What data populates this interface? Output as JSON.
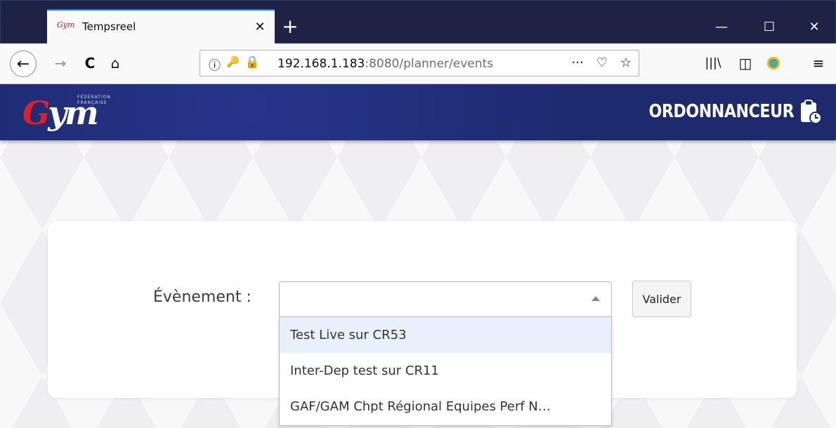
{
  "browser": {
    "tab": {
      "title": "Tempsreel",
      "favicon_text": "Gym"
    },
    "url": {
      "host": "192.168.1.183",
      "rest": ":8080/planner/events"
    },
    "icons": {
      "back": "back-arrow-icon",
      "forward": "forward-arrow-icon",
      "reload": "reload-icon",
      "home": "home-icon",
      "info": "info-icon",
      "key": "key-icon",
      "insecure": "insecure-lock-icon",
      "page_actions": "more-dots-icon",
      "pocket": "pocket-icon",
      "bookmark": "star-icon",
      "library": "library-icon",
      "sidebar": "sidebar-icon",
      "extension": "extension-icon",
      "menu": "hamburger-icon"
    }
  },
  "header": {
    "logo_small": "FÉDÉRATION FRANÇAISE",
    "logo_script": "Gym",
    "app_title": "ORDONNANCEUR",
    "app_icon": "clipboard-clock-icon"
  },
  "form": {
    "label": "Évènement :",
    "select_value": "",
    "button_label": "Valider",
    "options": [
      "Test Live sur CR53",
      "Inter-Dep test sur CR11",
      "GAF/GAM Chpt Régional Equipes Perf N…"
    ]
  },
  "colors": {
    "tabbar": "#1e2346",
    "header": "#1d2a6e",
    "accent_tab": "#0a84ff",
    "highlight_option": "#e8f1fb",
    "logo_red": "#e21f26"
  }
}
